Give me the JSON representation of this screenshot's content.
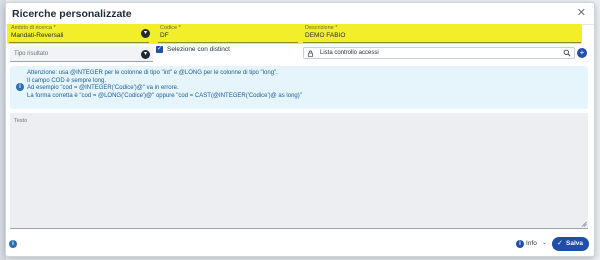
{
  "modal": {
    "title": "Ricerche personalizzate",
    "close_icon": "close-icon"
  },
  "ambito": {
    "label": "Ambito di ricerca *",
    "value": "Mandati-Reversali"
  },
  "codice": {
    "label": "Codice *",
    "value": "DF"
  },
  "descrizione": {
    "label": "Descrizione *",
    "value": "DEMO FABIO"
  },
  "tipo_risultato": {
    "placeholder": "Tipo risultato"
  },
  "selezione": {
    "label": "Selezione con distinct",
    "checked": true
  },
  "lista": {
    "value": "Lista controllo accessi"
  },
  "info_box": {
    "lines": [
      "Attenzione: usa @INTEGER per le colonne di tipo \"int\" e @LONG per le colonne di tipo \"long\".",
      "Il campo COD è sempre long.",
      "Ad esempio \"cod = @INTEGER('Codice')@\" va in errore.",
      "La forma corretta è \"cod = @LONG('Codice')@\" oppure \"cod = CAST(@INTEGER('Codice')@ as long)\""
    ]
  },
  "testo": {
    "label": "Testo"
  },
  "footer": {
    "info_label": "Info",
    "save_label": "Salva"
  },
  "colors": {
    "highlight": "#f2ef2a",
    "primary": "#1f4fa8",
    "info_bg": "#e6f4fb",
    "info_text": "#1a5d8f"
  }
}
